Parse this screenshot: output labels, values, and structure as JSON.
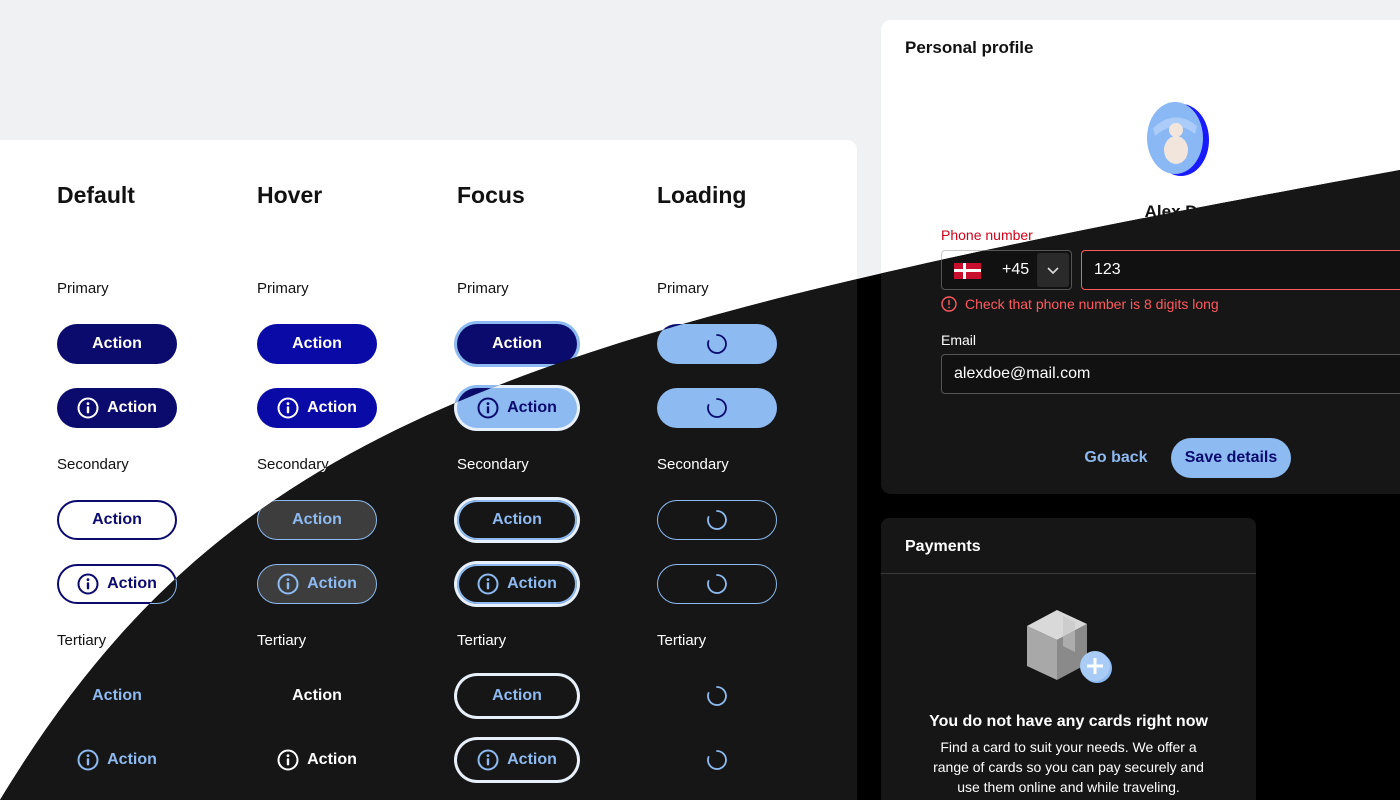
{
  "columns": {
    "default": "Default",
    "hover": "Hover",
    "focus": "Focus",
    "loading": "Loading"
  },
  "sections": {
    "primary": "Primary",
    "secondary": "Secondary",
    "tertiary": "Tertiary"
  },
  "button_label": "Action",
  "icons": {
    "info": "info-icon",
    "loading": "loading-spinner-icon",
    "chevron": "chevron-down-icon",
    "error": "error-icon"
  },
  "colors": {
    "primary_light": "#0b0b6e",
    "primary_hover_light": "#0a0aa6",
    "primary_dark": "#8dbaf0",
    "focus_ring": "#8dbaf0",
    "error": "#d0021b",
    "dark_surface": "#161616"
  },
  "profile": {
    "title": "Personal profile",
    "name": "Alex Doe",
    "phone_label": "Phone number",
    "country_code": "+45",
    "country_flag": "Denmark flag",
    "phone_value": "123",
    "phone_error": "Check that phone number is 8 digits long",
    "email_label": "Email",
    "email_value": "alexdoe@mail.com",
    "go_back": "Go back",
    "save": "Save details"
  },
  "payments": {
    "title": "Payments",
    "empty_heading": "You do not have any cards right now",
    "empty_body": "Find a card to suit your needs. We offer a range of cards so you can pay securely and use them online and while traveling."
  }
}
